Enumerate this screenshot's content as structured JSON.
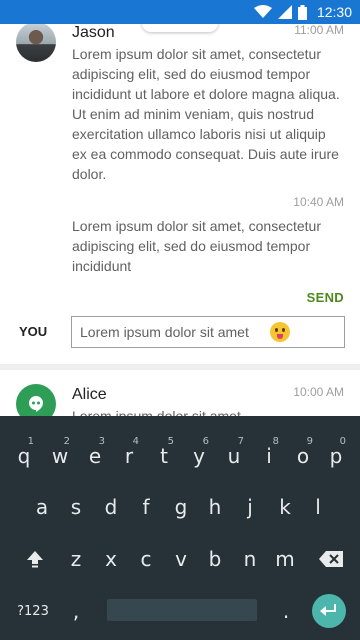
{
  "status_bar": {
    "time": "12:30",
    "icons": [
      "wifi-icon",
      "cellular-icon",
      "battery-icon"
    ],
    "color": "#1976d2"
  },
  "thread1": {
    "contact_name": "Jason",
    "messages": [
      {
        "time": "11:00 AM",
        "text": "Lorem ipsum dolor sit amet, consectetur adipiscing elit, sed do eiusmod tempor incididunt ut labore et dolore magna aliqua. Ut enim ad minim veniam, quis nostrud exercitation ullamco laboris nisi ut aliquip ex ea commodo consequat. Duis aute irure dolor."
      },
      {
        "time": "10:40 AM",
        "text": "Lorem ipsum dolor sit amet, consectetur adipiscing elit, sed do eiusmod tempor incididunt"
      }
    ],
    "send_label": "SEND",
    "you_label": "YOU",
    "reply_value": "Lorem ipsum dolor sit amet",
    "accent_color": "#4c8a1f"
  },
  "thread2": {
    "contact_name": "Alice",
    "time": "10:00 AM",
    "text": "Lorem ipsum dolor sit amet"
  },
  "keyboard": {
    "row1": [
      {
        "key": "q",
        "num": "1"
      },
      {
        "key": "w",
        "num": "2"
      },
      {
        "key": "e",
        "num": "3"
      },
      {
        "key": "r",
        "num": "4"
      },
      {
        "key": "t",
        "num": "5"
      },
      {
        "key": "y",
        "num": "6"
      },
      {
        "key": "u",
        "num": "7"
      },
      {
        "key": "i",
        "num": "8"
      },
      {
        "key": "o",
        "num": "9"
      },
      {
        "key": "p",
        "num": "0"
      }
    ],
    "row2": [
      "a",
      "s",
      "d",
      "f",
      "g",
      "h",
      "j",
      "k",
      "l"
    ],
    "row3": [
      "z",
      "x",
      "c",
      "v",
      "b",
      "n",
      "m"
    ],
    "symbols_label": "?123",
    "comma": ",",
    "period": ".",
    "bg_color": "#263238",
    "enter_color": "#4db6ac"
  }
}
